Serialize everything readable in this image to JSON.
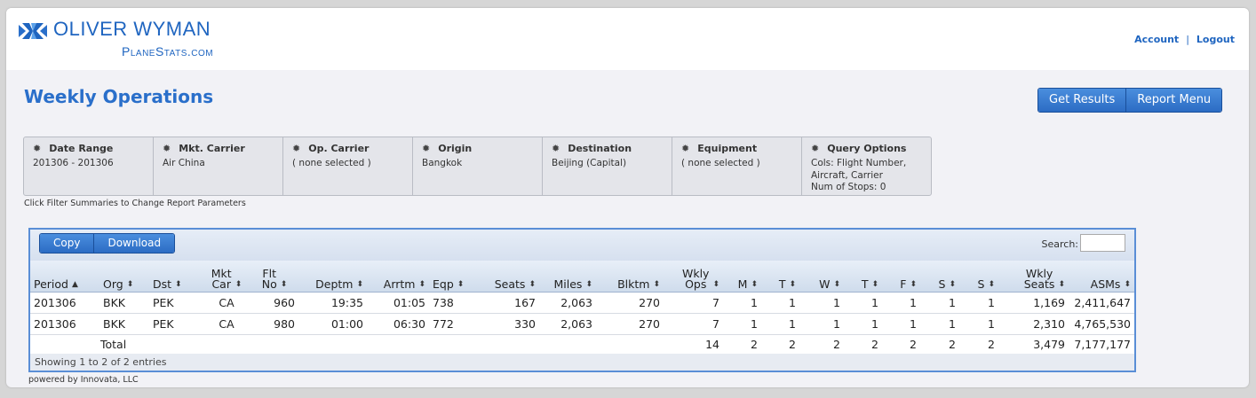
{
  "brand": {
    "name": "OLIVER WYMAN",
    "sub": "PlaneStats.com",
    "color": "#1f65c0"
  },
  "account": {
    "account_label": "Account",
    "sep": "|",
    "logout_label": "Logout"
  },
  "page_title": "Weekly Operations",
  "actions": {
    "get_results": "Get Results",
    "report_menu": "Report Menu"
  },
  "filters": [
    {
      "title": "Date Range",
      "value": "201306 - 201306",
      "icon": "gear-icon"
    },
    {
      "title": "Mkt. Carrier",
      "value": "Air China",
      "icon": "gear-icon"
    },
    {
      "title": "Op. Carrier",
      "value": "( none selected )",
      "icon": "gear-icon"
    },
    {
      "title": "Origin",
      "value": "Bangkok",
      "icon": "gear-icon"
    },
    {
      "title": "Destination",
      "value": "Beijing (Capital)",
      "icon": "gear-icon"
    },
    {
      "title": "Equipment",
      "value": "( none selected )",
      "icon": "gear-icon"
    },
    {
      "title": "Query Options",
      "value": "Cols: Flight Number,\nAircraft, Carrier\nNum of Stops: 0",
      "icon": "gear-icon"
    }
  ],
  "hint": "Click Filter Summaries to Change Report Parameters",
  "table": {
    "copy_label": "Copy",
    "download_label": "Download",
    "search_label": "Search:",
    "search_value": "",
    "columns": [
      "Period",
      "Org",
      "Dst",
      "Mkt Car",
      "Flt No",
      "Deptm",
      "Arrtm",
      "Eqp",
      "Seats",
      "Miles",
      "Blktm",
      "Wkly Ops",
      "M",
      "T",
      "W",
      "T",
      "F",
      "S",
      "S",
      "Wkly Seats",
      "ASMs"
    ],
    "sorted_column": "Period",
    "rows": [
      [
        "201306",
        "BKK",
        "PEK",
        "CA",
        "960",
        "19:35",
        "01:05",
        "738",
        "167",
        "2,063",
        "270",
        "7",
        "1",
        "1",
        "1",
        "1",
        "1",
        "1",
        "1",
        "1,169",
        "2,411,647"
      ],
      [
        "201306",
        "BKK",
        "PEK",
        "CA",
        "980",
        "01:00",
        "06:30",
        "772",
        "330",
        "2,063",
        "270",
        "7",
        "1",
        "1",
        "1",
        "1",
        "1",
        "1",
        "1",
        "2,310",
        "4,765,530"
      ]
    ],
    "total": {
      "label": "Total",
      "wkly_ops": "14",
      "days": [
        "2",
        "2",
        "2",
        "2",
        "2",
        "2",
        "2"
      ],
      "wkly_seats": "3,479",
      "asms": "7,177,177"
    },
    "showing": "Showing 1 to 2 of 2 entries"
  },
  "powered_by": "powered by Innovata, LLC",
  "colors": {
    "accent": "#2a6fca",
    "button": "#2c6cc4",
    "table_border": "#5a8ed6"
  }
}
